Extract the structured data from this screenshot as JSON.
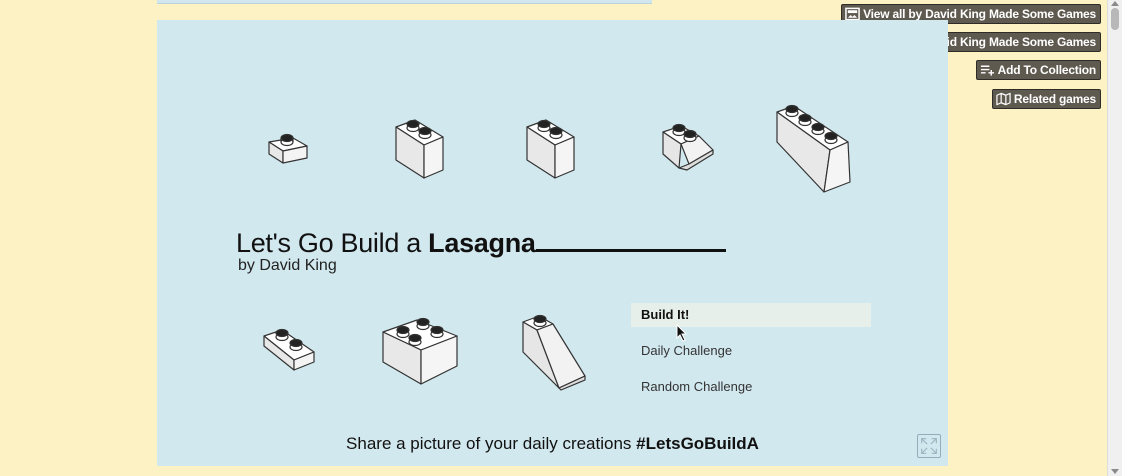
{
  "sidebar_buttons": [
    {
      "label": "View all by David King Made Some Games",
      "icon": "gallery-icon"
    },
    {
      "label": "Follow David King Made Some Games",
      "icon": "add-user-icon"
    },
    {
      "label": "Add To Collection",
      "icon": "playlist-add-icon"
    },
    {
      "label": "Related games",
      "icon": "map-icon"
    }
  ],
  "game": {
    "title_prefix": "Let's Go Build a ",
    "title_word": "Lasagna",
    "byline": "by David King",
    "menu": [
      {
        "label": "Build It!",
        "active": true
      },
      {
        "label": "Daily Challenge",
        "active": false
      },
      {
        "label": "Random Challenge",
        "active": false
      }
    ],
    "footer_text": "Share a picture of your daily creations ",
    "footer_hashtag": "#LetsGoBuildA"
  },
  "colors": {
    "page_bg": "#fdf2c4",
    "game_bg": "#d2e8ef",
    "button_bg": "#5f5a50"
  }
}
